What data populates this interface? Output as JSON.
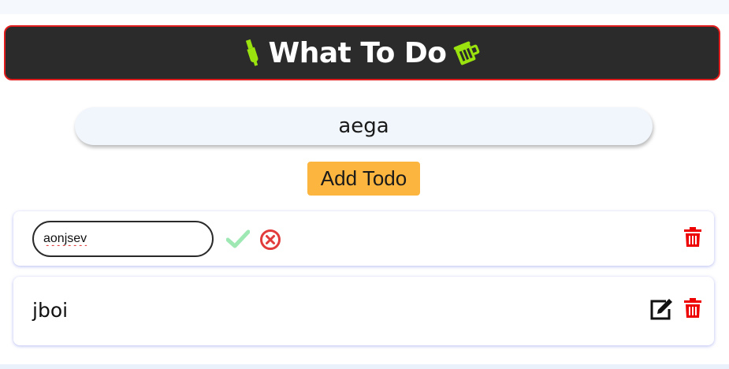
{
  "header": {
    "title": "What To Do",
    "left_icon": "highlighter-icon",
    "right_icon": "beer-mug-icon",
    "icon_color": "#9be30f",
    "background": "#2b2b2b",
    "border_color": "#e11d1d"
  },
  "new_todo": {
    "value": "aega",
    "add_label": "Add Todo",
    "button_color": "#fcb63f"
  },
  "todos": [
    {
      "mode": "editing",
      "edit_value": "aonjsev",
      "actions": [
        "check-icon",
        "cancel-icon",
        "trash-icon"
      ]
    },
    {
      "mode": "view",
      "text": "jboi",
      "actions": [
        "edit-icon",
        "trash-icon"
      ]
    }
  ],
  "colors": {
    "check": "#9ee8b4",
    "cancel": "#e23b3b",
    "trash": "#ee0000",
    "edit": "#111111"
  }
}
